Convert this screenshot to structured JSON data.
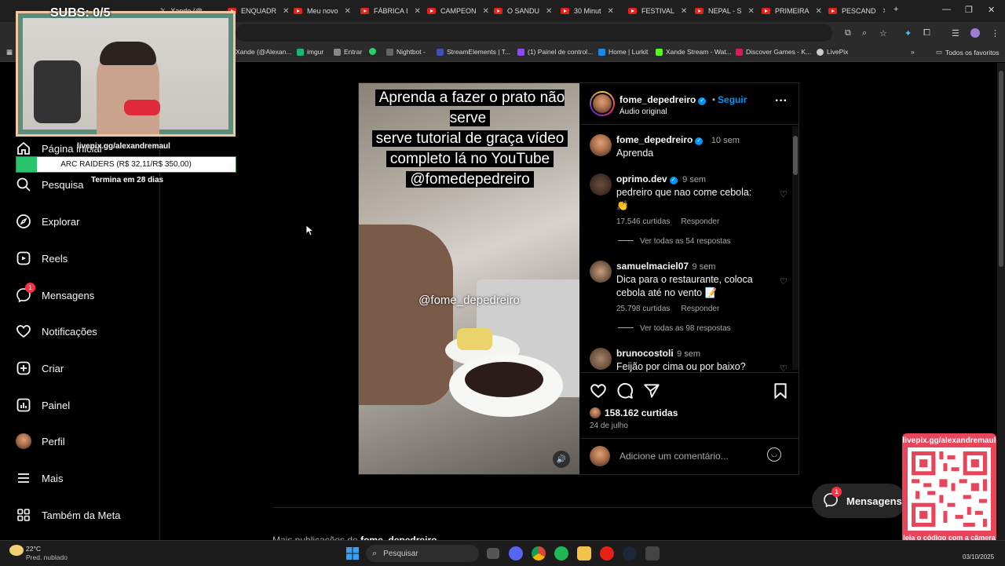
{
  "browser": {
    "tabs": [
      {
        "label": "Xande (@..."
      },
      {
        "label": "ENQUADR"
      },
      {
        "label": "Meu novo"
      },
      {
        "label": "FÁBRICA I"
      },
      {
        "label": "CAMPEON"
      },
      {
        "label": "O SANDU"
      },
      {
        "label": "30 Minut"
      },
      {
        "label": "FESTIVAL"
      },
      {
        "label": "NEPAL - S"
      },
      {
        "label": "PRIMEIRA"
      },
      {
        "label": "PESCAND"
      }
    ],
    "bookmarks": [
      {
        "label": "Xande (@Alexan...",
        "color": "#c13584"
      },
      {
        "label": "imgur",
        "color": "#1bb76e"
      },
      {
        "label": "Entrar",
        "color": "#888888"
      },
      {
        "label": "",
        "color": "#25d366"
      },
      {
        "label": "Nightbot -",
        "color": "#666666"
      },
      {
        "label": "StreamElements | T...",
        "color": "#3f51b5"
      },
      {
        "label": "(1) Painel de control...",
        "color": "#9146ff"
      },
      {
        "label": "Home | Lurkit",
        "color": "#1e88e5"
      },
      {
        "label": "Xande Stream - Wat...",
        "color": "#53fc18"
      },
      {
        "label": "Discover Games - K...",
        "color": "#d81b60"
      },
      {
        "label": "LivePix",
        "color": "#cccccc"
      }
    ],
    "favorites_label": "Todos os favoritos"
  },
  "overlay": {
    "subs": "SUBS: 0/5",
    "goal_url": "livepix.gg/alexandremaul",
    "goal_text": "ARC RAIDERS (R$ 32,11/R$ 350,00)",
    "goal_progress": 0.0917,
    "goal_end": "Termina em 28 dias",
    "qr_url": "livepix.gg/alexandremaul",
    "qr_caption": "leia o código com a câmera do celular."
  },
  "nav": {
    "items": [
      {
        "label": "Página inicial",
        "icon": "home-icon"
      },
      {
        "label": "Pesquisa",
        "icon": "search-icon"
      },
      {
        "label": "Explorar",
        "icon": "compass-icon"
      },
      {
        "label": "Reels",
        "icon": "reels-icon"
      },
      {
        "label": "Mensagens",
        "icon": "messenger-icon",
        "badge": "1"
      },
      {
        "label": "Notificações",
        "icon": "heart-icon"
      },
      {
        "label": "Criar",
        "icon": "plus-square-icon"
      },
      {
        "label": "Painel",
        "icon": "chart-icon"
      },
      {
        "label": "Perfil",
        "icon": "avatar"
      },
      {
        "label": "Mais",
        "icon": "menu-icon"
      },
      {
        "label": "Também da Meta",
        "icon": "meta-icon"
      }
    ]
  },
  "post": {
    "video_caption_lines": [
      "Aprenda a fazer o prato não serve",
      "serve tutorial de graça vídeo",
      "completo lá no YouTube",
      "@fomedepedreiro"
    ],
    "watermark": "@fome_depedreiro",
    "author": "fome_depedreiro",
    "follow": "Seguir",
    "audio": "Áudio original",
    "caption": {
      "user": "fome_depedreiro",
      "time": "10 sem",
      "text": "Aprenda"
    },
    "comments": [
      {
        "user": "oprimo.dev",
        "verified": true,
        "time": "9 sem",
        "text": "pedreiro que nao come cebola: 👏",
        "likes": "17.546 curtidas",
        "reply": "Responder",
        "view_replies": "Ver todas as 54 respostas"
      },
      {
        "user": "samuelmaciel07",
        "verified": false,
        "time": "9 sem",
        "text": "Dica para o restaurante, coloca cebola até no vento 📝",
        "likes": "25.798 curtidas",
        "reply": "Responder",
        "view_replies": "Ver todas as 98 respostas"
      },
      {
        "user": "brunocostoli",
        "verified": false,
        "time": "9 sem",
        "text": "Feijão por cima ou por baixo?",
        "likes": "",
        "reply": "",
        "view_replies": ""
      }
    ],
    "likes": "158.162 curtidas",
    "date": "24 de julho",
    "add_comment_placeholder": "Adicione um comentário..."
  },
  "page": {
    "more_posts_prefix": "Mais publicações de",
    "more_posts_user": "fome_depedreiro",
    "messages_pill": "Mensagens",
    "messages_badge": "1"
  },
  "taskbar": {
    "weather_temp": "22°C",
    "weather_desc": "Pred. nublado",
    "search_placeholder": "Pesquisar",
    "date": "03/10/2025"
  }
}
